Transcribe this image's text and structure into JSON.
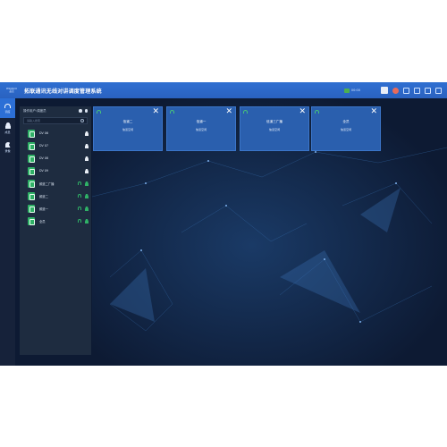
{
  "titlebar": {
    "logo_line1": "PINGNUO",
    "logo_line2": "品诺",
    "app_title": "拓联通讯无线对讲调度管理系统",
    "status_text": "00:00"
  },
  "nav": {
    "items": [
      {
        "label": "调度",
        "icon": "headset-icon"
      },
      {
        "label": "成员",
        "icon": "person-icon"
      },
      {
        "label": "录像",
        "icon": "flag-icon"
      }
    ]
  },
  "panel": {
    "header_text": "操作用户:调度员",
    "search_placeholder": "请输入搜索",
    "items": [
      {
        "label": "DV 06",
        "status": "offline"
      },
      {
        "label": "DV 07",
        "status": "offline"
      },
      {
        "label": "DV 08",
        "status": "offline"
      },
      {
        "label": "DV 09",
        "status": "offline"
      },
      {
        "label": "频道二广播",
        "status": "online"
      },
      {
        "label": "频道二",
        "status": "online"
      },
      {
        "label": "频道一",
        "status": "online"
      },
      {
        "label": "全员",
        "status": "online"
      }
    ]
  },
  "channels": [
    {
      "name": "信道二",
      "state": "信道空闲"
    },
    {
      "name": "信道一",
      "state": "信道空闲"
    },
    {
      "name": "信道三广播",
      "state": "信道空闲"
    },
    {
      "name": "全员",
      "state": "信道空闲"
    }
  ],
  "colors": {
    "titlebar": "#2f6fd1",
    "background": "#0d1a33",
    "card": "#2a5fae",
    "online": "#2fb166"
  }
}
